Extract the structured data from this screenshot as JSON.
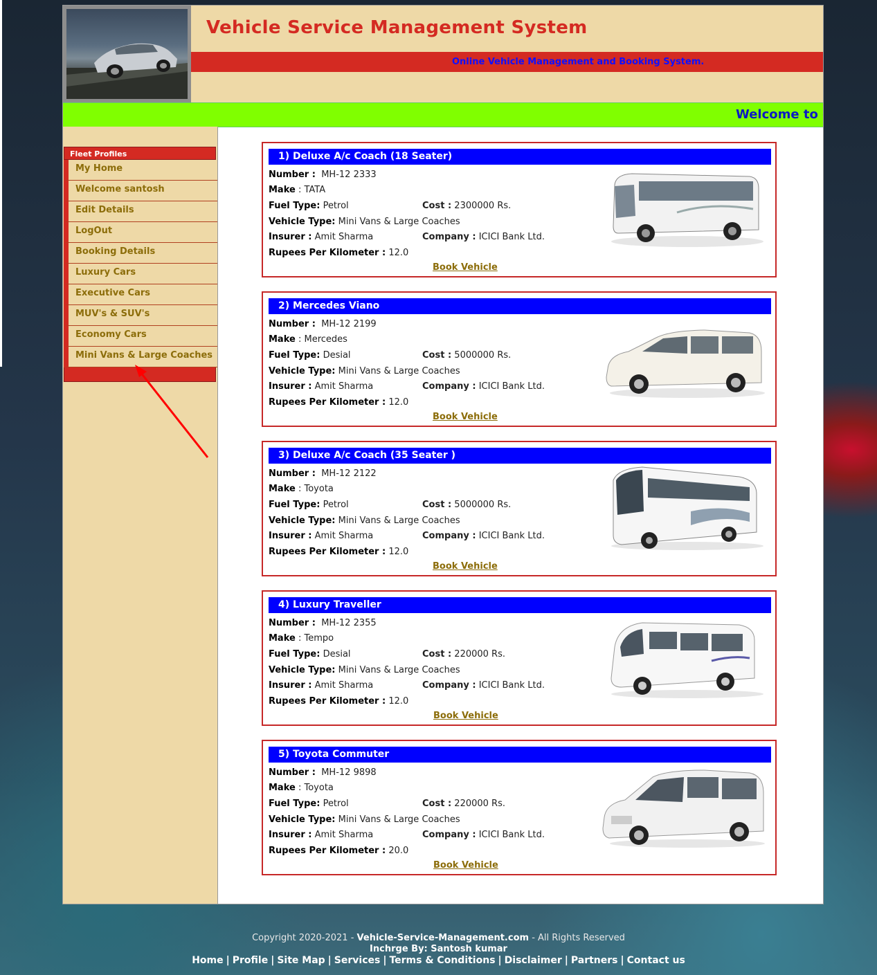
{
  "header": {
    "title": "Vehicle Service Management System",
    "tagline": "Online Vehicle Management and Booking System.",
    "marquee": "Welcome to c"
  },
  "sidebar": {
    "heading": "Fleet Profiles",
    "items": [
      {
        "label": "My Home"
      },
      {
        "label": "Welcome santosh"
      },
      {
        "label": "Edit Details"
      },
      {
        "label": "LogOut"
      },
      {
        "label": "Booking Details"
      },
      {
        "label": "Luxury Cars"
      },
      {
        "label": "Executive Cars"
      },
      {
        "label": "MUV's & SUV's"
      },
      {
        "label": "Economy Cars"
      },
      {
        "label": "Mini Vans & Large Coaches"
      }
    ]
  },
  "labels": {
    "number": "Number :",
    "make": "Make",
    "fuel": "Fuel Type:",
    "cost": "Cost :",
    "vtype": "Vehicle Type:",
    "insurer": "Insurer :",
    "company": "Company :",
    "rpk": "Rupees Per Kilometer :",
    "book": "Book Vehicle"
  },
  "vehicles": [
    {
      "title": "1)  Deluxe A/c Coach (18 Seater)",
      "number": "MH-12 2333",
      "make": ": TATA",
      "fuel": "Petrol",
      "cost": "2300000 Rs.",
      "vtype": "Mini Vans & Large Coaches",
      "insurer": "Amit Sharma",
      "company": "ICICI Bank Ltd.",
      "rpk": "12.0",
      "image": "bus-icon"
    },
    {
      "title": "2)  Mercedes Viano",
      "number": "MH-12 2199",
      "make": ": Mercedes",
      "fuel": "Desial",
      "cost": "5000000 Rs.",
      "vtype": "Mini Vans & Large Coaches",
      "insurer": "Amit Sharma",
      "company": "ICICI Bank Ltd.",
      "rpk": "12.0",
      "image": "van-icon"
    },
    {
      "title": "3) Deluxe A/c Coach (35 Seater )",
      "number": "MH-12 2122",
      "make": ": Toyota",
      "fuel": "Petrol",
      "cost": "5000000 Rs.",
      "vtype": "Mini Vans & Large Coaches",
      "insurer": "Amit Sharma",
      "company": "ICICI Bank Ltd.",
      "rpk": "12.0",
      "image": "coach-icon"
    },
    {
      "title": "4) Luxury Traveller",
      "number": "MH-12 2355",
      "make": ": Tempo",
      "fuel": "Desial",
      "cost": "220000 Rs.",
      "vtype": "Mini Vans & Large Coaches",
      "insurer": "Amit Sharma",
      "company": "ICICI Bank Ltd.",
      "rpk": "12.0",
      "image": "minibus-icon"
    },
    {
      "title": "5) Toyota Commuter",
      "number": "MH-12 9898",
      "make": ": Toyota",
      "fuel": "Petrol",
      "cost": "220000 Rs.",
      "vtype": "Mini Vans & Large Coaches",
      "insurer": "Amit Sharma",
      "company": "ICICI Bank Ltd.",
      "rpk": "20.0",
      "image": "van-icon"
    }
  ],
  "footer": {
    "copy_prefix": "Copyright 2020-2021 -",
    "site": "Vehicle-Service-Management.com",
    "copy_suffix": "- All Rights Reserved",
    "incharge": "Inchrge By: Santosh kumar",
    "links": [
      "Home",
      "Profile",
      "Site Map",
      "Services",
      "Terms & Conditions",
      "Disclaimer",
      "Partners",
      "Contact us"
    ]
  },
  "colors": {
    "brand_red": "#d42a22",
    "header_bg": "#eed9a7",
    "marquee_bar": "#80ff00",
    "card_title_bg": "#0000ff",
    "menu_text": "#8c6d0a"
  }
}
